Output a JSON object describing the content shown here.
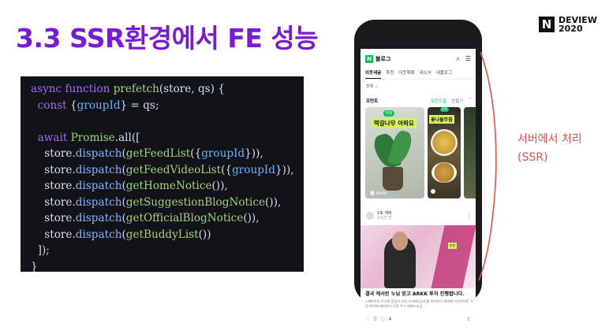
{
  "slide": {
    "title": "3.3 SSR환경에서 FE 성능",
    "title_color": "#7a1ad6",
    "brand": {
      "logo": "N",
      "line1": "DEVIEW",
      "line2": "2020"
    }
  },
  "code": {
    "lines": [
      [
        {
          "t": "async function ",
          "c": "kw"
        },
        {
          "t": "prefetch",
          "c": "fn"
        },
        {
          "t": "(store, qs) {",
          "c": ""
        }
      ],
      [
        {
          "t": "  const ",
          "c": "kw"
        },
        {
          "t": "{",
          "c": ""
        },
        {
          "t": "groupId",
          "c": "pr"
        },
        {
          "t": "} = qs;",
          "c": ""
        }
      ],
      [
        {
          "t": "",
          "c": ""
        }
      ],
      [
        {
          "t": "  await ",
          "c": "kw"
        },
        {
          "t": "Promise",
          "c": "fn"
        },
        {
          "t": ".all([",
          "c": ""
        }
      ],
      [
        {
          "t": "    store.",
          "c": ""
        },
        {
          "t": "dispatch",
          "c": "lt"
        },
        {
          "t": "(",
          "c": ""
        },
        {
          "t": "getFeedList",
          "c": "fn"
        },
        {
          "t": "({",
          "c": ""
        },
        {
          "t": "groupId",
          "c": "pr"
        },
        {
          "t": "})),",
          "c": ""
        }
      ],
      [
        {
          "t": "    store.",
          "c": ""
        },
        {
          "t": "dispatch",
          "c": "lt"
        },
        {
          "t": "(",
          "c": ""
        },
        {
          "t": "getFeedVideoList",
          "c": "fn"
        },
        {
          "t": "({",
          "c": ""
        },
        {
          "t": "groupId",
          "c": "pr"
        },
        {
          "t": "})),",
          "c": ""
        }
      ],
      [
        {
          "t": "    store.",
          "c": ""
        },
        {
          "t": "dispatch",
          "c": "lt"
        },
        {
          "t": "(",
          "c": ""
        },
        {
          "t": "getHomeNotice",
          "c": "fn"
        },
        {
          "t": "()),",
          "c": ""
        }
      ],
      [
        {
          "t": "    store.",
          "c": ""
        },
        {
          "t": "dispatch",
          "c": "lt"
        },
        {
          "t": "(",
          "c": ""
        },
        {
          "t": "getSuggestionBlogNotice",
          "c": "fn"
        },
        {
          "t": "()),",
          "c": ""
        }
      ],
      [
        {
          "t": "    store.",
          "c": ""
        },
        {
          "t": "dispatch",
          "c": "lt"
        },
        {
          "t": "(",
          "c": ""
        },
        {
          "t": "getOfficialBlogNotice",
          "c": "fn"
        },
        {
          "t": "()),",
          "c": ""
        }
      ],
      [
        {
          "t": "    store.",
          "c": ""
        },
        {
          "t": "dispatch",
          "c": "lt"
        },
        {
          "t": "(",
          "c": ""
        },
        {
          "t": "getBuddyList",
          "c": "fn"
        },
        {
          "t": "())",
          "c": ""
        }
      ],
      [
        {
          "t": "  ]);",
          "c": ""
        }
      ],
      [
        {
          "t": "}",
          "c": ""
        }
      ]
    ]
  },
  "phone": {
    "app": {
      "logo": "N",
      "name": "블로그",
      "search_icon": "search-icon",
      "menu_icon": "menu-icon"
    },
    "tabs": [
      "이웃새글",
      "추천",
      "이웃목록",
      "내소식",
      "내블로그"
    ],
    "active_tab": 0,
    "filter_label": "전체 ⌄",
    "moment": {
      "title": "모먼트",
      "link1": "모먼트홈",
      "link2": "만들기",
      "chevron": "⌃"
    },
    "cards": {
      "card1": {
        "badge": "추천",
        "caption": "떡갈나무 아파요",
        "user": "INORM"
      },
      "card2": {
        "badge": "추천",
        "caption": "꽃나들무침"
      }
    },
    "post": {
      "author": "1호 재택",
      "time": "2시간 전",
      "more": "⋮",
      "image_tag": "추천",
      "title": "결국 케서린 누님 믿고 ARKK 투자 진행합니다.",
      "body": "스페이X와 주식에 관심이 가지 시가배당금부를 여러분이 계약해 이끈한테로 꾸알 여러에 때더보니 단일 주식 애에스조금 ...",
      "likes": "3",
      "comments": "4"
    }
  },
  "annotation": {
    "label_line1": "서버에서 처리",
    "label_line2": "(SSR)",
    "color": "#e74e4e"
  }
}
